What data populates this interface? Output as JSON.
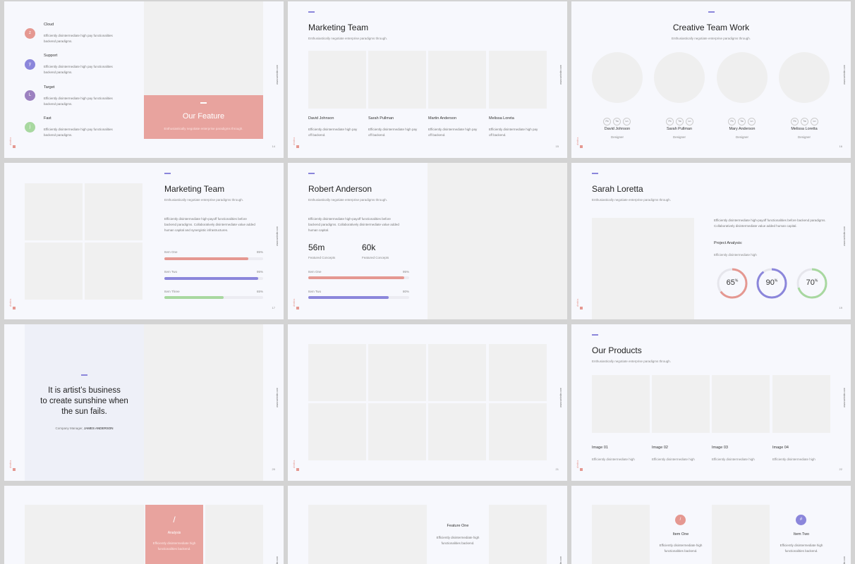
{
  "common": {
    "brand": "dimitria",
    "url": "www.website.com"
  },
  "s14": {
    "page": "14",
    "items": [
      {
        "glyph": "z",
        "title": "Cloud",
        "text": "Efficiently disintermediate high pay functionalities backend paradigms.",
        "color": "#e59891"
      },
      {
        "glyph": "y",
        "title": "Support",
        "text": "Efficiently disintermediate high pay functionalities backend paradigms.",
        "color": "#8b86db"
      },
      {
        "glyph": "L",
        "title": "Target",
        "text": "Efficiently disintermediate high pay functionalities backend paradigms.",
        "color": "#9c81c0"
      },
      {
        "glyph": "j",
        "title": "Fast",
        "text": "Efficiently disintermediate high pay functionalities backend paradigms.",
        "color": "#a8d8a0"
      }
    ],
    "feature_title": "Our Feature",
    "feature_sub": "Enthusiastically negotiate enterprise paradigms through."
  },
  "s15": {
    "page": "15",
    "title": "Marketing Team",
    "subtitle": "Enthusiastically negotiate enterprise paradigms through.",
    "members": [
      {
        "name": "David Johnson",
        "text": "Efficiently disintermediate high pay off backend."
      },
      {
        "name": "Sarah Pullman",
        "text": "Efficiently disintermediate high pay off backend."
      },
      {
        "name": "Martin Anderson",
        "text": "Efficiently disintermediate high pay off backend."
      },
      {
        "name": "Melissa Loreta",
        "text": "Efficiently disintermediate high pay off backend."
      }
    ]
  },
  "s16": {
    "page": "16",
    "title": "Creative Team Work",
    "subtitle": "Enthusiastically negotiate enterprise paradigms through.",
    "social": [
      "Fb",
      "Tw",
      "Ln"
    ],
    "members": [
      {
        "name": "David Johnson",
        "role": "Designer"
      },
      {
        "name": "Sarah Pullman",
        "role": "Designer"
      },
      {
        "name": "Mary Anderson",
        "role": "Designer"
      },
      {
        "name": "Melissa Loretta",
        "role": "Designer"
      }
    ]
  },
  "s17": {
    "page": "17",
    "title": "Marketing Team",
    "subtitle": "Enthusiastically negotiate enterprise paradigms through.",
    "body": "Efficiently disintermediate high-payoff functionalities before backend paradigms. Collaboratively disintermediate value added human capital and synergistic infrastructures.",
    "bars": [
      {
        "label": "Item One",
        "pct": "85%",
        "value": 0.85,
        "color": "#e59891"
      },
      {
        "label": "Item Two",
        "pct": "95%",
        "value": 0.95,
        "color": "#8b86db"
      },
      {
        "label": "Item Three",
        "pct": "65%",
        "value": 0.6,
        "color": "#a8d8a0"
      }
    ]
  },
  "s18": {
    "title": "Robert Anderson",
    "subtitle": "Enthusiastically negotiate enterprise paradigms through.",
    "body": "Efficiently disintermediate high-payoff functionalities before backend paradigms. Collaboratively disintermediate value added human capital.",
    "stats": [
      {
        "value": "56m",
        "label": "Featured Concepts"
      },
      {
        "value": "60k",
        "label": "Featured Concepts"
      }
    ],
    "bars": [
      {
        "label": "Item One",
        "pct": "95%",
        "value": 0.95,
        "color": "#e59891"
      },
      {
        "label": "Item Two",
        "pct": "80%",
        "value": 0.8,
        "color": "#8b86db"
      }
    ]
  },
  "s19": {
    "page": "19",
    "title": "Sarah Loretta",
    "subtitle": "Enthusiastically negotiate enterprise paradigms through.",
    "body": "Efficiently disintermediate high-payoff functionalities before backend paradigms. Collaboratively disintermediate value added human capital.",
    "analysis_title": "Project Analysis:",
    "analysis_sub": "Efficiently disintermediate high",
    "rings": [
      {
        "value": "65",
        "unit": "%",
        "fraction": 0.65,
        "color": "#e59891"
      },
      {
        "value": "90",
        "unit": "%",
        "fraction": 0.9,
        "color": "#8b86db"
      },
      {
        "value": "70",
        "unit": "%",
        "fraction": 0.7,
        "color": "#a8d8a0"
      }
    ]
  },
  "s20": {
    "page": "20",
    "quote_lines": [
      "It is artist’s business",
      "to create sunshine when",
      "the sun fails."
    ],
    "role": "Company Manager,",
    "author": "JAMES ANDERSON"
  },
  "s21": {
    "page": "21"
  },
  "s22": {
    "page": "22",
    "title": "Our Products",
    "subtitle": "Enthusiastically negotiate enterprise paradigms through.",
    "products": [
      {
        "name": "Image 01",
        "text": "Efficiently disintermediate high"
      },
      {
        "name": "Image 02",
        "text": "Efficiently disintermediate high"
      },
      {
        "name": "Image 03",
        "text": "Efficiently disintermediate high"
      },
      {
        "name": "Image 04",
        "text": "Efficiently disintermediate high"
      }
    ]
  },
  "s23": {
    "glyph": "/",
    "title": "Analysis",
    "text": "Efficiently disintermediate high functionalities backend."
  },
  "s24": {
    "title": "Feature One",
    "text": "Efficiently disintermediate high functionalities backend."
  },
  "s25": {
    "items": [
      {
        "glyph": "/",
        "title": "Item One",
        "text": "Efficiently disintermediate high functionalities backend.",
        "color": "#e59891"
      },
      {
        "glyph": "#",
        "title": "Item Two",
        "text": "Efficiently disintermediate high functionalities backend.",
        "color": "#8b86db"
      }
    ]
  }
}
